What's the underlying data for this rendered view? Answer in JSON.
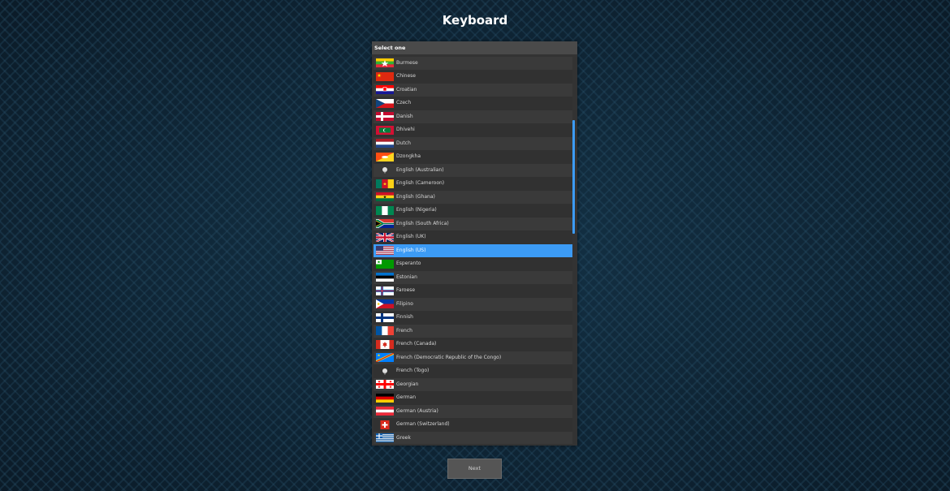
{
  "page": {
    "title": "Keyboard"
  },
  "list": {
    "header": "Select one",
    "selected_index": 14,
    "items": [
      {
        "label": "Burmese",
        "flag": "burma"
      },
      {
        "label": "Chinese",
        "flag": "china"
      },
      {
        "label": "Croatian",
        "flag": "croatia"
      },
      {
        "label": "Czech",
        "flag": "czech"
      },
      {
        "label": "Danish",
        "flag": "denmark"
      },
      {
        "label": "Dhivehi",
        "flag": "maldives"
      },
      {
        "label": "Dutch",
        "flag": "netherlands"
      },
      {
        "label": "Dzongkha",
        "flag": "bhutan"
      },
      {
        "label": "English (Australian)",
        "flag": "generic"
      },
      {
        "label": "English (Cameroon)",
        "flag": "cameroon"
      },
      {
        "label": "English (Ghana)",
        "flag": "ghana"
      },
      {
        "label": "English (Nigeria)",
        "flag": "nigeria"
      },
      {
        "label": "English (South Africa)",
        "flag": "south-africa"
      },
      {
        "label": "English (UK)",
        "flag": "uk"
      },
      {
        "label": "English (US)",
        "flag": "us"
      },
      {
        "label": "Esperanto",
        "flag": "esperanto"
      },
      {
        "label": "Estonian",
        "flag": "estonia"
      },
      {
        "label": "Faroese",
        "flag": "faroe"
      },
      {
        "label": "Filipino",
        "flag": "philippines"
      },
      {
        "label": "Finnish",
        "flag": "finland"
      },
      {
        "label": "French",
        "flag": "france"
      },
      {
        "label": "French (Canada)",
        "flag": "canada"
      },
      {
        "label": "French (Democratic Republic of the Congo)",
        "flag": "drc"
      },
      {
        "label": "French (Togo)",
        "flag": "generic"
      },
      {
        "label": "Georgian",
        "flag": "georgia"
      },
      {
        "label": "German",
        "flag": "germany"
      },
      {
        "label": "German (Austria)",
        "flag": "austria"
      },
      {
        "label": "German (Switzerland)",
        "flag": "switzerland"
      },
      {
        "label": "Greek",
        "flag": "greece"
      }
    ]
  },
  "footer": {
    "next_label": "Next"
  },
  "colors": {
    "accent": "#3c9bf5"
  }
}
